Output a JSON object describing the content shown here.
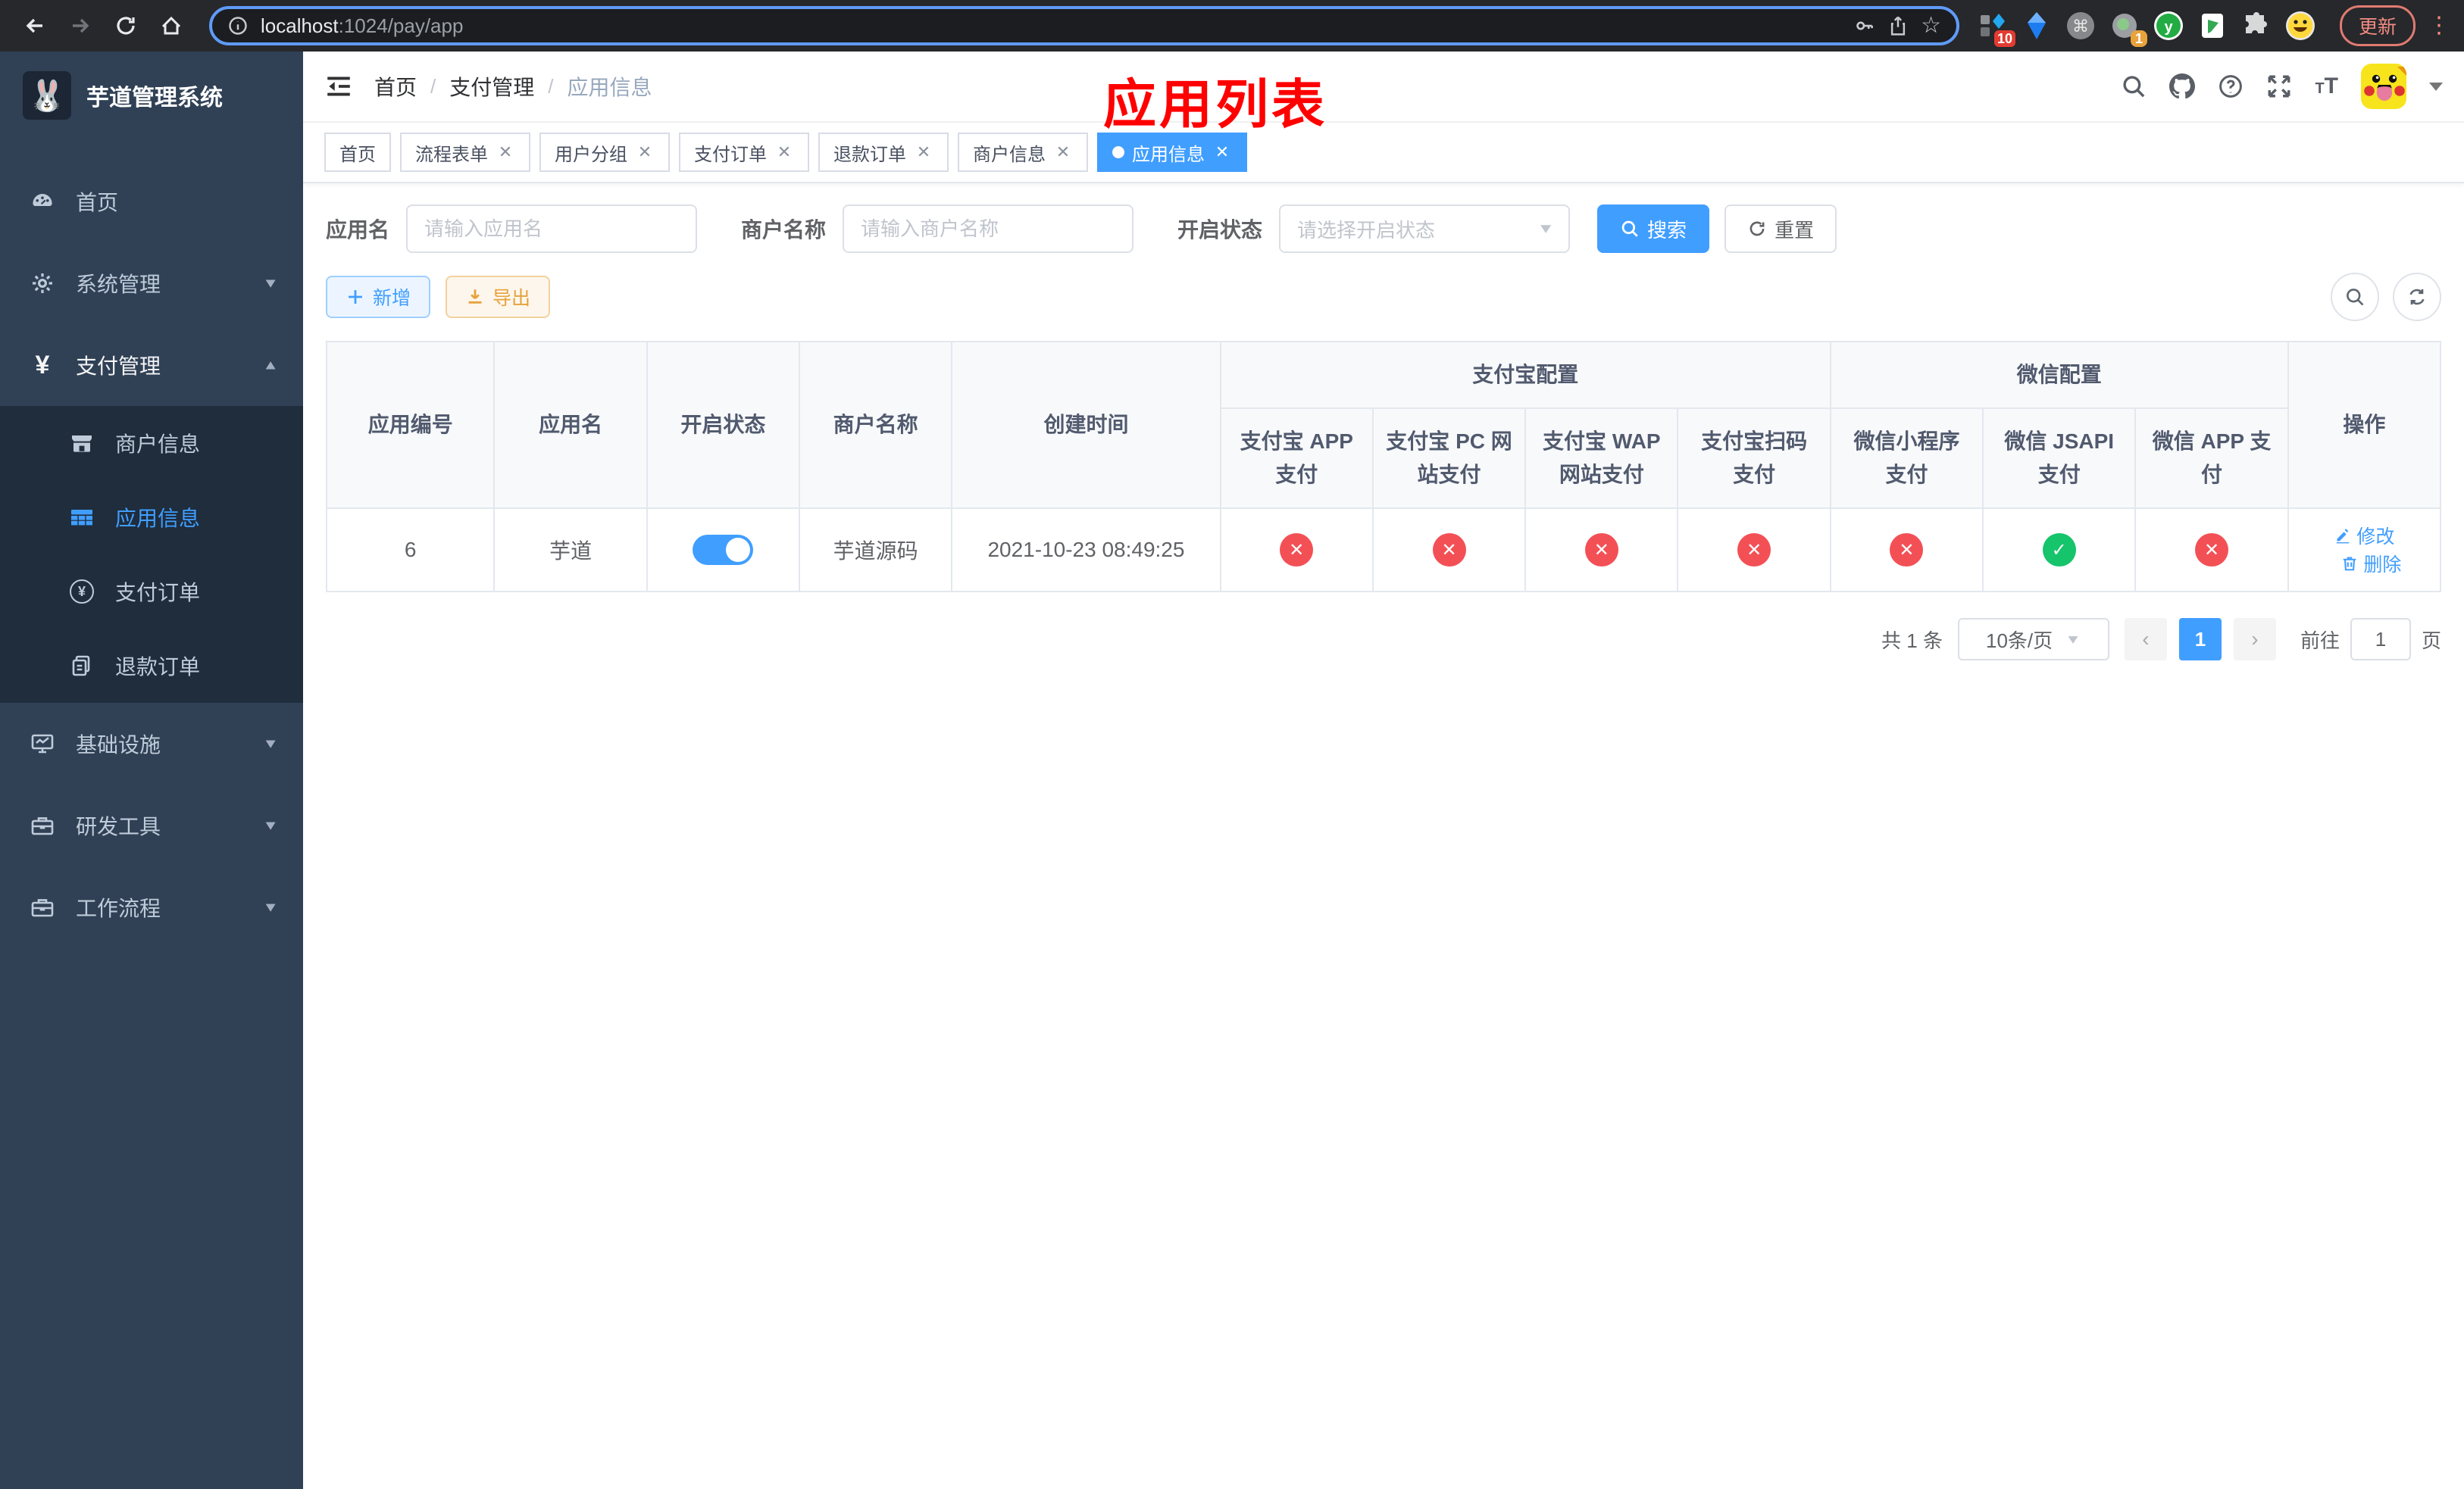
{
  "browser": {
    "url_host": "localhost",
    "url_path": ":1024/pay/app",
    "update_button": "更新",
    "extension_badges": {
      "pin": "10",
      "session": "1"
    }
  },
  "sidebar": {
    "title": "芋道管理系统",
    "menu": [
      {
        "label": "首页"
      },
      {
        "label": "系统管理"
      },
      {
        "label": "支付管理"
      },
      {
        "label": "基础设施"
      },
      {
        "label": "研发工具"
      },
      {
        "label": "工作流程"
      }
    ],
    "payment_submenu": [
      {
        "label": "商户信息",
        "active": false
      },
      {
        "label": "应用信息",
        "active": true
      },
      {
        "label": "支付订单",
        "active": false
      },
      {
        "label": "退款订单",
        "active": false
      }
    ]
  },
  "navbar": {
    "breadcrumb": [
      "首页",
      "支付管理",
      "应用信息"
    ],
    "annotation": "应用列表"
  },
  "tags": [
    {
      "label": "首页",
      "closable": false,
      "active": false
    },
    {
      "label": "流程表单",
      "closable": true,
      "active": false
    },
    {
      "label": "用户分组",
      "closable": true,
      "active": false
    },
    {
      "label": "支付订单",
      "closable": true,
      "active": false
    },
    {
      "label": "退款订单",
      "closable": true,
      "active": false
    },
    {
      "label": "商户信息",
      "closable": true,
      "active": false
    },
    {
      "label": "应用信息",
      "closable": true,
      "active": true
    }
  ],
  "filter": {
    "app_name_label": "应用名",
    "app_name_placeholder": "请输入应用名",
    "merchant_label": "商户名称",
    "merchant_placeholder": "请输入商户名称",
    "status_label": "开启状态",
    "status_placeholder": "请选择开启状态",
    "search_label": "搜索",
    "reset_label": "重置"
  },
  "toolbar": {
    "add_label": "新增",
    "export_label": "导出"
  },
  "table": {
    "group_alipay": "支付宝配置",
    "group_wechat": "微信配置",
    "columns": [
      "应用编号",
      "应用名",
      "开启状态",
      "商户名称",
      "创建时间",
      "支付宝 APP 支付",
      "支付宝 PC 网站支付",
      "支付宝 WAP 网站支付",
      "支付宝扫码支付",
      "微信小程序支付",
      "微信 JSAPI 支付",
      "微信 APP 支付",
      "操作"
    ],
    "rows": [
      {
        "id": "6",
        "name": "芋道",
        "enabled": true,
        "merchant": "芋道源码",
        "created_at": "2021-10-23 08:49:25",
        "pay_statuses": [
          "fail",
          "fail",
          "fail",
          "fail",
          "fail",
          "ok",
          "fail"
        ],
        "edit_label": "修改",
        "delete_label": "删除"
      }
    ]
  },
  "pagination": {
    "total_text": "共 1 条",
    "page_size_text": "10条/页",
    "page": "1",
    "goto_label": "前往",
    "goto_value": "1",
    "page_unit": "页"
  },
  "colors": {
    "accent": "#409eff",
    "success": "#15c46b",
    "danger": "#f35056",
    "warning": "#e6a23c",
    "annotation": "#ff0000",
    "sidebar_bg": "#304156",
    "submenu_bg": "#1f2d3d"
  }
}
